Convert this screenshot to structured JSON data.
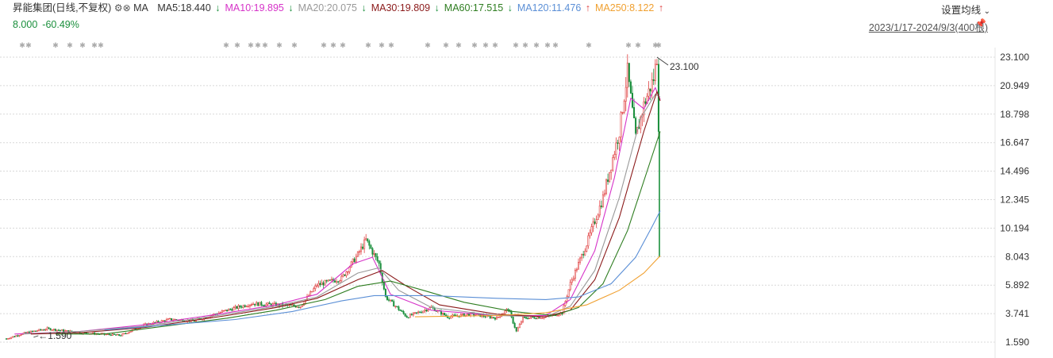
{
  "header": {
    "stock_name": "昇能集团",
    "period": "(日线,不复权)",
    "ma_label": "MA",
    "ma": [
      {
        "label": "MA5:18.440",
        "arrow": "↓",
        "color": "#333333"
      },
      {
        "label": "MA10:19.895",
        "arrow": "↓",
        "color": "#d633c8"
      },
      {
        "label": "MA20:20.075",
        "arrow": "↓",
        "color": "#999999"
      },
      {
        "label": "MA30:19.809",
        "arrow": "↓",
        "color": "#8b1a1a"
      },
      {
        "label": "MA60:17.515",
        "arrow": "↓",
        "color": "#2e7d20"
      },
      {
        "label": "MA120:11.476",
        "arrow": "↑",
        "color": "#5b8fd6"
      },
      {
        "label": "MA250:8.122",
        "arrow": "↑",
        "color": "#f0a030"
      }
    ],
    "settings_label": "设置均线",
    "settings_caret": "⌄",
    "price": "8.000",
    "change": "-60.49%",
    "date_range": "2023/1/17-2024/9/3(400根)"
  },
  "chart_data": {
    "type": "candlestick",
    "title": "",
    "xlabel": "",
    "ylabel": "",
    "y_ticks": [
      23.1,
      20.949,
      18.798,
      16.647,
      14.496,
      12.345,
      10.194,
      8.043,
      5.892,
      3.741,
      1.59
    ],
    "y_tick_labels": [
      "23.100",
      "20.949",
      "18.798",
      "16.647",
      "14.496",
      "12.345",
      "10.194",
      "8.043",
      "5.892",
      "3.741",
      "1.590"
    ],
    "ylim": [
      1.59,
      23.1
    ],
    "max_label": "23.100",
    "min_label": "1.590",
    "grid": true,
    "close_series": [
      [
        0,
        1.85
      ],
      [
        12,
        2.3
      ],
      [
        25,
        2.6
      ],
      [
        45,
        2.3
      ],
      [
        70,
        2.1
      ],
      [
        85,
        2.9
      ],
      [
        100,
        3.3
      ],
      [
        115,
        3.2
      ],
      [
        135,
        4.0
      ],
      [
        150,
        4.5
      ],
      [
        165,
        4.4
      ],
      [
        180,
        4.3
      ],
      [
        190,
        5.9
      ],
      [
        205,
        6.4
      ],
      [
        215,
        8.2
      ],
      [
        220,
        9.3
      ],
      [
        228,
        7.5
      ],
      [
        232,
        5.0
      ],
      [
        245,
        3.5
      ],
      [
        260,
        4.2
      ],
      [
        270,
        3.5
      ],
      [
        285,
        3.7
      ],
      [
        300,
        3.4
      ],
      [
        307,
        4.1
      ],
      [
        312,
        2.4
      ],
      [
        316,
        3.4
      ],
      [
        330,
        3.5
      ],
      [
        340,
        3.8
      ],
      [
        345,
        6.0
      ],
      [
        355,
        9.0
      ],
      [
        365,
        12.5
      ],
      [
        375,
        17.5
      ],
      [
        380,
        22.0
      ],
      [
        385,
        17.0
      ],
      [
        390,
        19.5
      ],
      [
        396,
        21.5
      ],
      [
        398,
        23.1
      ],
      [
        399,
        18.0
      ],
      [
        400,
        8.0
      ]
    ],
    "ma_series": [
      {
        "name": "MA10",
        "color": "#d633c8",
        "points": [
          [
            5,
            2.2
          ],
          [
            45,
            2.4
          ],
          [
            85,
            2.9
          ],
          [
            135,
            3.8
          ],
          [
            165,
            4.4
          ],
          [
            190,
            5.2
          ],
          [
            212,
            7.5
          ],
          [
            224,
            8.0
          ],
          [
            235,
            5.2
          ],
          [
            260,
            4.0
          ],
          [
            300,
            3.6
          ],
          [
            330,
            3.6
          ],
          [
            345,
            4.8
          ],
          [
            360,
            8.5
          ],
          [
            372,
            14.0
          ],
          [
            382,
            20.0
          ],
          [
            390,
            19.2
          ],
          [
            397,
            20.8
          ],
          [
            400,
            19.9
          ]
        ]
      },
      {
        "name": "MA20",
        "color": "#999999",
        "points": [
          [
            10,
            2.2
          ],
          [
            45,
            2.4
          ],
          [
            85,
            2.8
          ],
          [
            135,
            3.7
          ],
          [
            165,
            4.3
          ],
          [
            190,
            5.0
          ],
          [
            215,
            6.8
          ],
          [
            228,
            7.2
          ],
          [
            240,
            5.5
          ],
          [
            260,
            4.2
          ],
          [
            300,
            3.6
          ],
          [
            330,
            3.5
          ],
          [
            345,
            4.3
          ],
          [
            360,
            7.0
          ],
          [
            375,
            12.5
          ],
          [
            388,
            18.5
          ],
          [
            397,
            20.3
          ],
          [
            400,
            20.1
          ]
        ]
      },
      {
        "name": "MA30",
        "color": "#8b1a1a",
        "points": [
          [
            15,
            2.2
          ],
          [
            45,
            2.3
          ],
          [
            85,
            2.7
          ],
          [
            135,
            3.6
          ],
          [
            165,
            4.2
          ],
          [
            190,
            4.9
          ],
          [
            215,
            6.3
          ],
          [
            230,
            7.0
          ],
          [
            245,
            5.8
          ],
          [
            265,
            4.4
          ],
          [
            300,
            3.7
          ],
          [
            330,
            3.5
          ],
          [
            345,
            4.0
          ],
          [
            360,
            6.3
          ],
          [
            375,
            11.0
          ],
          [
            390,
            17.5
          ],
          [
            398,
            20.5
          ],
          [
            400,
            19.8
          ]
        ]
      },
      {
        "name": "MA60",
        "color": "#2e7d20",
        "points": [
          [
            30,
            2.2
          ],
          [
            60,
            2.2
          ],
          [
            85,
            2.6
          ],
          [
            135,
            3.4
          ],
          [
            165,
            4.0
          ],
          [
            195,
            4.8
          ],
          [
            215,
            5.8
          ],
          [
            235,
            6.2
          ],
          [
            255,
            5.5
          ],
          [
            280,
            4.6
          ],
          [
            310,
            3.9
          ],
          [
            335,
            3.6
          ],
          [
            350,
            4.2
          ],
          [
            365,
            6.0
          ],
          [
            380,
            10.0
          ],
          [
            392,
            14.5
          ],
          [
            400,
            17.5
          ]
        ]
      },
      {
        "name": "MA120",
        "color": "#5b8fd6",
        "points": [
          [
            60,
            2.5
          ],
          [
            100,
            2.9
          ],
          [
            140,
            3.3
          ],
          [
            175,
            3.9
          ],
          [
            205,
            4.7
          ],
          [
            225,
            5.1
          ],
          [
            260,
            5.1
          ],
          [
            300,
            4.9
          ],
          [
            330,
            4.8
          ],
          [
            350,
            5.0
          ],
          [
            370,
            6.0
          ],
          [
            385,
            8.0
          ],
          [
            395,
            10.3
          ],
          [
            400,
            11.5
          ]
        ]
      },
      {
        "name": "MA250",
        "color": "#f0a030",
        "points": [
          [
            250,
            3.5
          ],
          [
            300,
            3.6
          ],
          [
            330,
            3.8
          ],
          [
            355,
            4.4
          ],
          [
            375,
            5.5
          ],
          [
            390,
            6.8
          ],
          [
            400,
            8.1
          ]
        ]
      }
    ],
    "volume_hint": "none"
  }
}
